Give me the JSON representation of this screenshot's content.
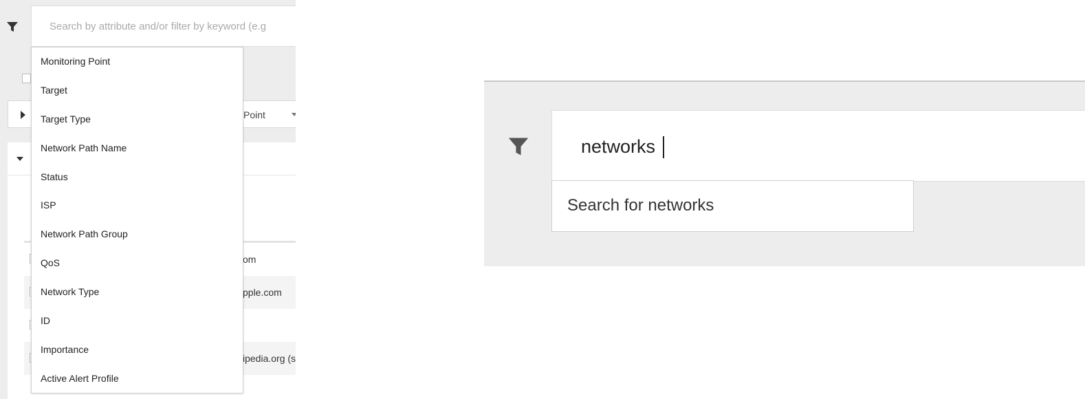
{
  "left": {
    "search": {
      "placeholder": "Search by attribute and/or filter by keyword (e.g"
    },
    "column_header": "Point",
    "attribute_menu": [
      "Monitoring Point",
      "Target",
      "Target Type",
      "Network Path Name",
      "Status",
      "ISP",
      "Network Path Group",
      "QoS",
      "Network Type",
      "ID",
      "Importance",
      "Active Alert Profile"
    ],
    "table_rows": [
      {
        "target": "om"
      },
      {
        "target": "pple.com"
      },
      {
        "target": ""
      },
      {
        "target": "ipedia.org (s"
      }
    ]
  },
  "right": {
    "search": {
      "value": "networks"
    },
    "suggestion": "Search for networks"
  },
  "colors": {
    "panel_bg": "#ededed",
    "icon": "#333333",
    "placeholder": "#a9a9a9"
  },
  "icons": {
    "filter": "funnel-filter-icon"
  }
}
